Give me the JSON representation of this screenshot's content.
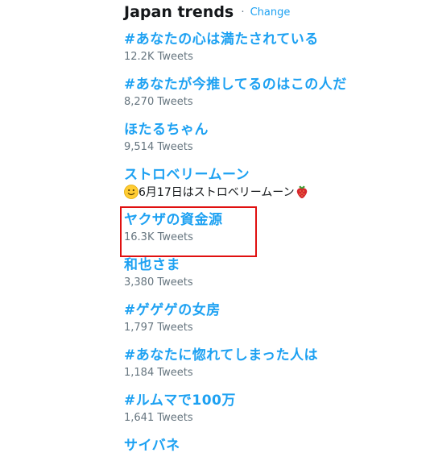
{
  "header": {
    "title": "Japan trends",
    "separator": "·",
    "change_label": "Change"
  },
  "trends": [
    {
      "name": "#あなたの心は満たされている",
      "count": "12.2K Tweets"
    },
    {
      "name": "#あなたが今推してるのはこの人だ",
      "count": "8,270 Tweets"
    },
    {
      "name": "ほたるちゃん",
      "count": "9,514 Tweets"
    },
    {
      "name": "ストロベリームーン",
      "description": "6月17日はストロベリームーン",
      "description_icons": [
        "smiley-face-icon",
        "strawberry-icon"
      ]
    },
    {
      "name": "ヤクザの資金源",
      "count": "16.3K Tweets",
      "highlighted": true
    },
    {
      "name": "和也さま",
      "count": "3,380 Tweets"
    },
    {
      "name": "#ゲゲゲの女房",
      "count": "1,797 Tweets"
    },
    {
      "name": "#あなたに惚れてしまった人は",
      "count": "1,184 Tweets"
    },
    {
      "name": "#ルムマで100万",
      "count": "1,641 Tweets"
    },
    {
      "name": "サイバネ"
    }
  ],
  "colors": {
    "link": "#1da1f2",
    "title": "#14171a",
    "count": "#66757f",
    "highlight_box": "#e01010"
  }
}
